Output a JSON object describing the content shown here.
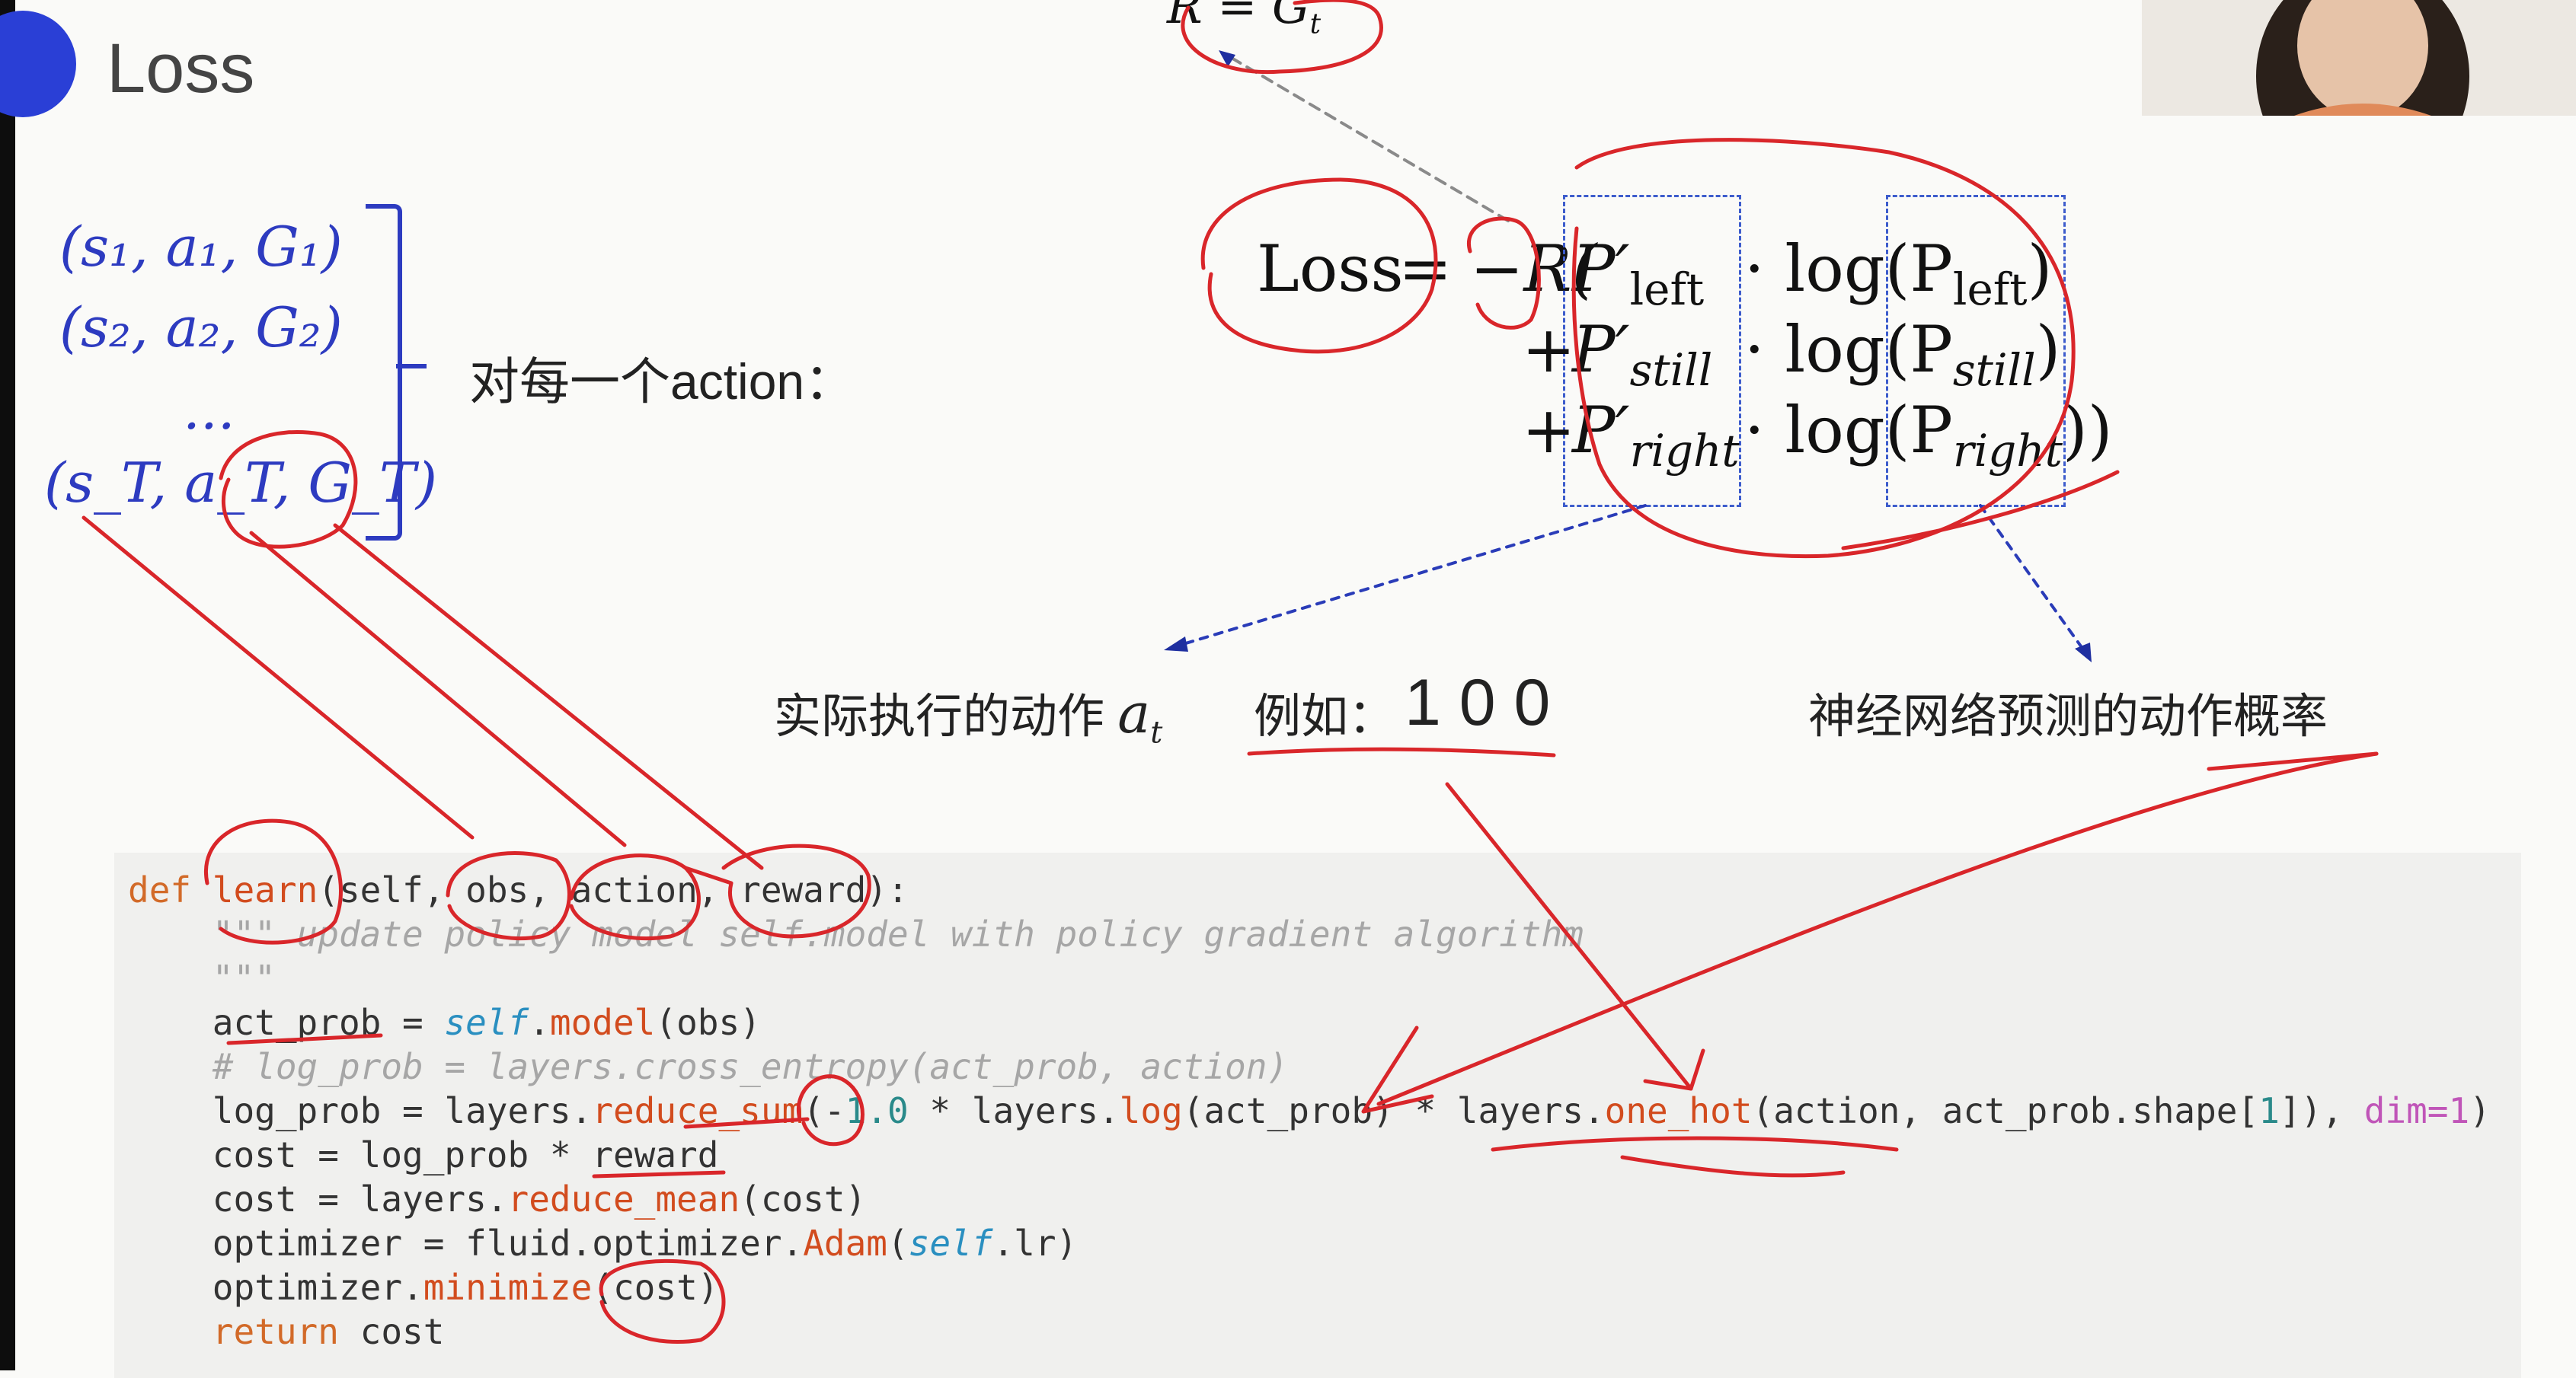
{
  "slide": {
    "title": "Loss",
    "tuples": [
      "(s₁, a₁, G₁)",
      "(s₂, a₂, G₂)",
      "...",
      "(s_T, a_T, G_T)"
    ],
    "per_action_label": "对每一个action：",
    "formula": {
      "top_label": "R = G",
      "top_label_sub": "t",
      "loss_label": "Loss",
      "equals": "=",
      "minus_r": "−R(",
      "p_prefix": "P′",
      "left_sub": "left",
      "still_sub": "still",
      "right_sub": "right",
      "plus": "+",
      "dot": "·",
      "log_open": "log(P",
      "log_left_sub": "left",
      "log_still_sub": "still",
      "log_right_sub": "right",
      "close": ")",
      "close_last": "))"
    },
    "captions": {
      "actual_action": "实际执行的动作",
      "actual_action_var": "a",
      "actual_action_sub": "t",
      "example_label": "例如：",
      "example_value": "1 0 0",
      "predicted_prob": "神经网络预测的动作概率"
    }
  },
  "code": {
    "l1_kw": "def",
    "l1_fn": "learn",
    "l1_rest": "(self, obs, action, reward):",
    "l2": "    \"\"\" update policy model self.model with policy gradient algorithm",
    "l3": "    \"\"\"",
    "l4_a": "    act_prob = ",
    "l4_self": "self",
    "l4_b": ".",
    "l4_fn": "model",
    "l4_c": "(obs)",
    "l5": "    # log_prob = layers.cross_entropy(act_prob, action)",
    "l6_a": "    log_prob = layers.",
    "l6_fn1": "reduce_sum",
    "l6_b": "(-",
    "l6_num": "1.0",
    "l6_c": " * layers.",
    "l6_fn2": "log",
    "l6_d": "(act_prob) * layers.",
    "l6_fn3": "one_hot",
    "l6_e": "(action, act_prob.shape[",
    "l6_num2": "1",
    "l6_f": "]), ",
    "l6_op": "dim=1",
    "l6_g": ")",
    "l7": "    cost = log_prob * reward",
    "l8_a": "    cost = layers.",
    "l8_fn": "reduce_mean",
    "l8_b": "(cost)",
    "l9_a": "    optimizer = fluid.optimizer.",
    "l9_fn": "Adam",
    "l9_b": "(",
    "l9_self": "self",
    "l9_c": ".lr)",
    "l10_a": "    optimizer.",
    "l10_fn": "minimize",
    "l10_b": "(cost)",
    "l11_kw": "    return",
    "l11_b": " cost"
  },
  "colors": {
    "accent_blue": "#2a3fd6",
    "tuple_blue": "#2d3bc0",
    "annotation_red": "#d9262a",
    "dashed_box": "#3d5ccc",
    "code_keyword": "#d26a28",
    "code_builtin": "#2a8fc0"
  }
}
